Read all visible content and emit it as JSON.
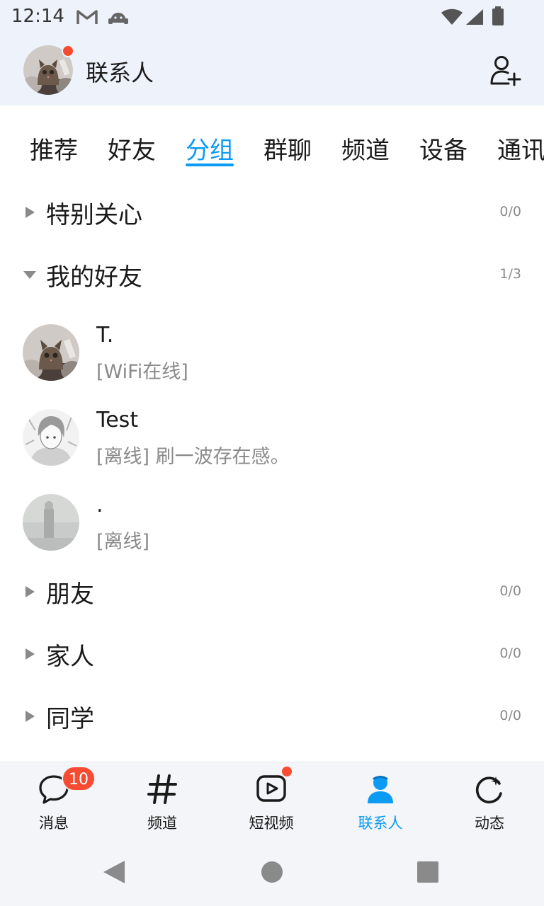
{
  "status_bar": {
    "time": "12:14",
    "icons": [
      "gmail-icon",
      "android-debug-icon",
      "wifi-icon",
      "cell-signal-icon",
      "battery-icon"
    ]
  },
  "header": {
    "title": "联系人",
    "avatar_icon": "cat-avatar",
    "has_notification_dot": true,
    "add_friend_icon": "add-person-icon"
  },
  "tabs": {
    "items": [
      "推荐",
      "好友",
      "分组",
      "群聊",
      "频道",
      "设备",
      "通讯录"
    ],
    "active": "分组"
  },
  "groups": [
    {
      "name": "特别关心",
      "count": "0/0",
      "expanded": false
    },
    {
      "name": "我的好友",
      "count": "1/3",
      "expanded": true
    },
    {
      "name": "朋友",
      "count": "0/0",
      "expanded": false
    },
    {
      "name": "家人",
      "count": "0/0",
      "expanded": false
    },
    {
      "name": "同学",
      "count": "0/0",
      "expanded": false
    }
  ],
  "friends": [
    {
      "name": "T.",
      "status": "[WiFi在线]",
      "avatar": "cat-avatar"
    },
    {
      "name": "Test",
      "status": "[离线] 刷一波存在感。",
      "avatar": "anime-avatar"
    },
    {
      "name": ".",
      "status": "[离线]",
      "avatar": "grey-photo-avatar"
    }
  ],
  "bottom_nav": {
    "items": [
      {
        "label": "消息",
        "icon": "chat-bubble-icon",
        "badge": "10"
      },
      {
        "label": "频道",
        "icon": "hashtag-icon"
      },
      {
        "label": "短视频",
        "icon": "video-play-icon",
        "dot": true
      },
      {
        "label": "联系人",
        "icon": "person-icon",
        "active": true
      },
      {
        "label": "动态",
        "icon": "refresh-star-icon"
      }
    ]
  },
  "colors": {
    "accent": "#0c9bf3",
    "badge": "#f74c31",
    "header_bg": "#eef2fb",
    "nav_bg": "#f4f5f8",
    "secondary_text": "#8a8a8a"
  }
}
